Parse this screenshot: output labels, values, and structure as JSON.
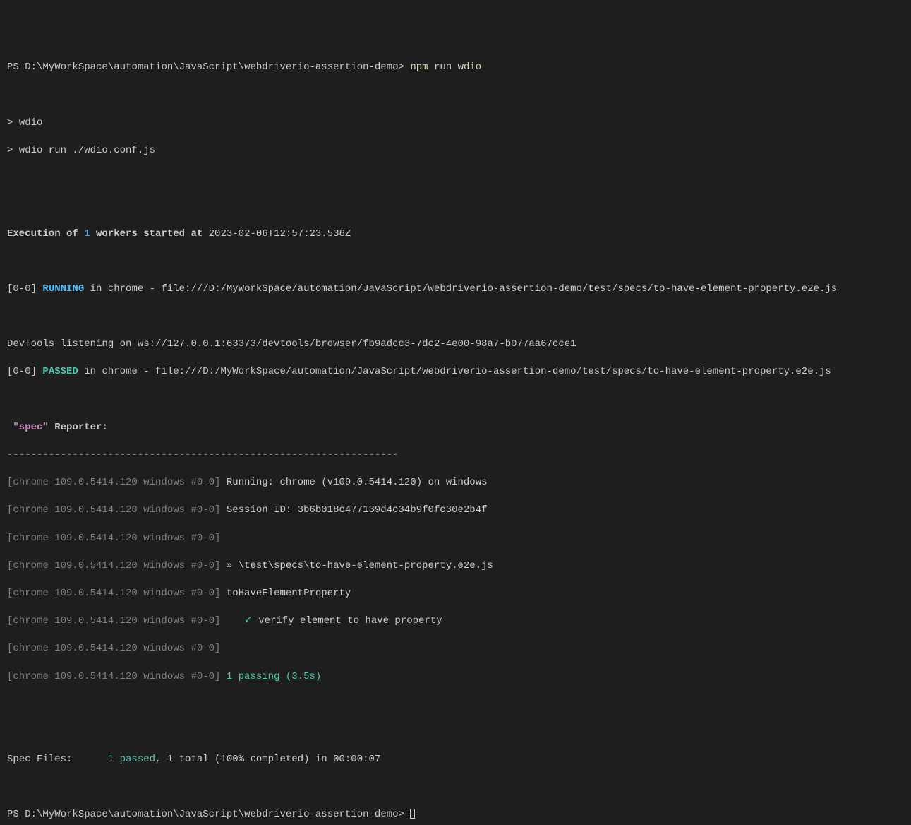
{
  "prompt1": {
    "prefix": "PS ",
    "path": "D:\\MyWorkSpace\\automation\\JavaScript\\webdriverio-assertion-demo",
    "sep": "> ",
    "cmd1": "npm",
    "cmd2": " run ",
    "cmd3": "wdio"
  },
  "echo": {
    "l1": "> wdio",
    "l2": "> wdio run ./wdio.conf.js"
  },
  "exec": {
    "p1": "Execution of ",
    "workers": "1",
    "p2": " workers started at ",
    "time": "2023-02-06T12:57:23.536Z"
  },
  "running": {
    "prefix": "[0-0] ",
    "status": "RUNNING",
    "mid": " in chrome - ",
    "file": "file:///D:/MyWorkSpace/automation/JavaScript/webdriverio-assertion-demo/test/specs/to-have-element-property.e2e.js"
  },
  "devtools": "DevTools listening on ws://127.0.0.1:63373/devtools/browser/fb9adcc3-7dc2-4e00-98a7-b077aa67cce1",
  "passed": {
    "prefix": "[0-0] ",
    "status": "PASSED",
    "mid": " in chrome - file:///D:/MyWorkSpace/automation/JavaScript/webdriverio-assertion-demo/test/specs/to-have-element-property.e2e.js"
  },
  "reporter": {
    "spec": " \"spec\"",
    "label": " Reporter:"
  },
  "divider": "------------------------------------------------------------------",
  "rows": {
    "prefix": "[chrome 109.0.5414.120 windows #0-0]",
    "r1": " Running: chrome (v109.0.5414.120) on windows",
    "r2": " Session ID: 3b6b018c477139d4c34b9f0fc30e2b4f",
    "r3": "",
    "r4": " » \\test\\specs\\to-have-element-property.e2e.js",
    "r5": " toHaveElementProperty",
    "r6_check": "    ✓ ",
    "r6_text": "verify element to have property",
    "r7": "",
    "r8": " 1 passing (3.5s)"
  },
  "summary": {
    "label": "Spec Files:      ",
    "passed": "1 passed",
    "rest": ", 1 total (100% completed) in 00:00:07"
  },
  "prompt2": {
    "prefix": "PS ",
    "path": "D:\\MyWorkSpace\\automation\\JavaScript\\webdriverio-assertion-demo",
    "sep": "> "
  }
}
